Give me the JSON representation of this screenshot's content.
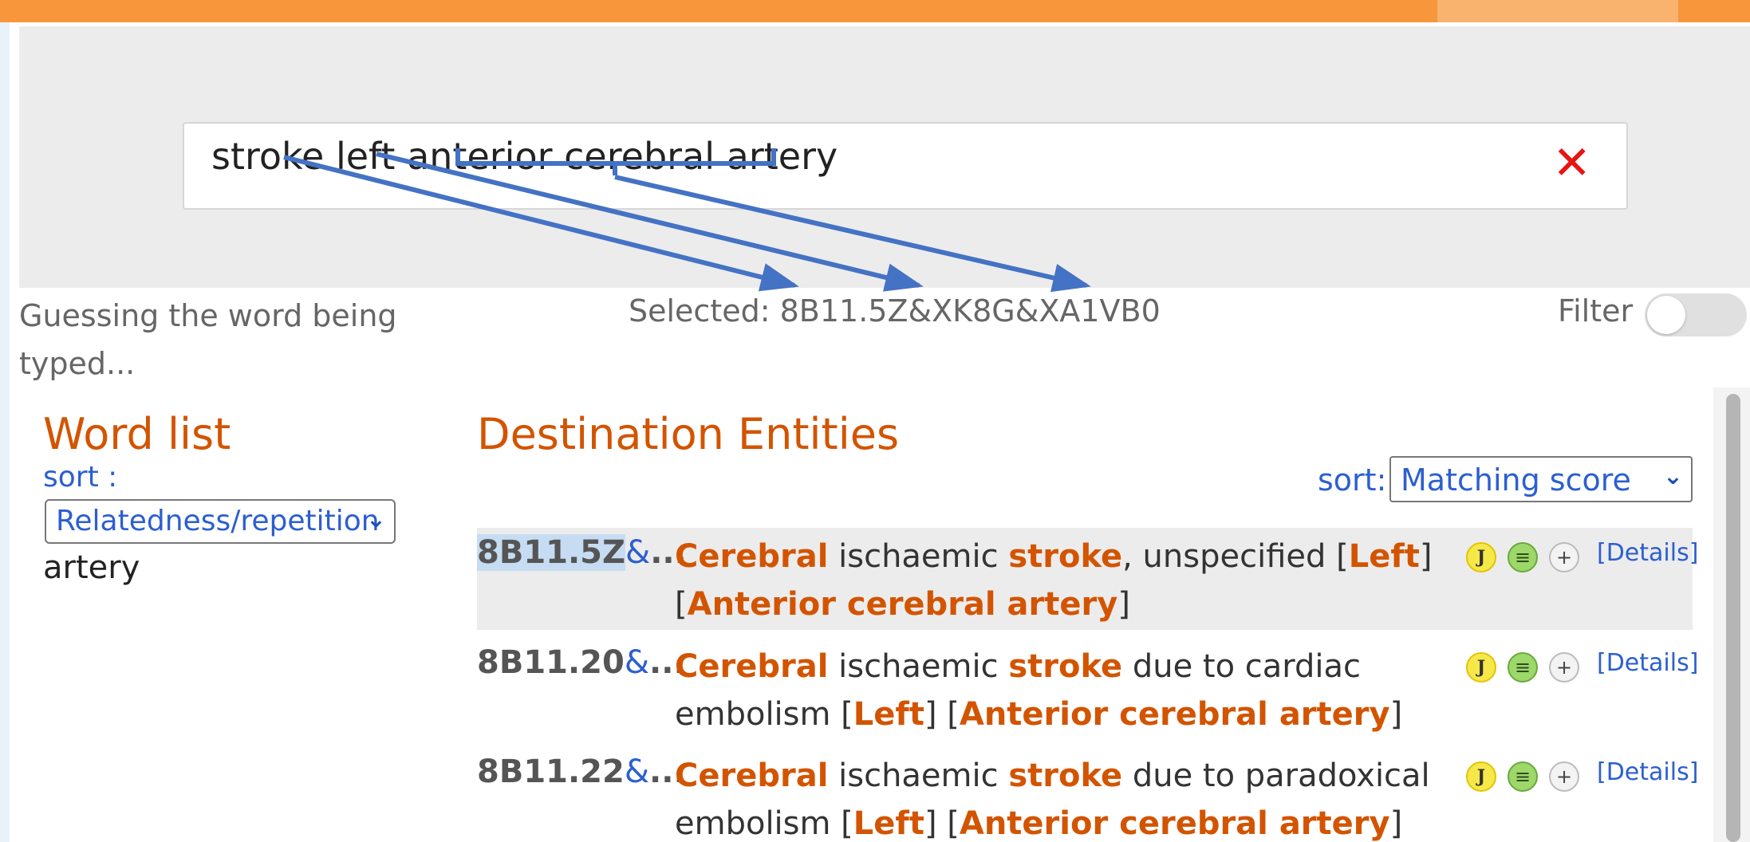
{
  "search": {
    "value": "stroke left anterior cerebral artery",
    "clear_icon": "close-icon"
  },
  "status": {
    "guessing": "Guessing the word being typed...",
    "selected": "Selected: 8B11.5Z&XK8G&XA1VB0",
    "filter_label": "Filter",
    "filter_on": false
  },
  "word_list": {
    "heading": "Word list",
    "sort_label": "sort :",
    "sort_value": "Relatedness/repetition",
    "words": [
      "artery"
    ]
  },
  "destination": {
    "heading": "Destination Entities",
    "sort_label": "sort:",
    "sort_value": "Matching score",
    "details_label": "[Details]",
    "results": [
      {
        "code": "8B11.5Z",
        "amp": "&",
        "ellipsis": "...",
        "segments": [
          {
            "text": "Cerebral",
            "hl": true
          },
          {
            "text": " ischaemic ",
            "hl": false
          },
          {
            "text": "stroke",
            "hl": true
          },
          {
            "text": ", unspecified [",
            "hl": false
          },
          {
            "text": "Left",
            "hl": true
          },
          {
            "text": "] [",
            "hl": false
          },
          {
            "text": "Anterior cerebral artery",
            "hl": true
          },
          {
            "text": "]",
            "hl": false
          }
        ]
      },
      {
        "code": "8B11.20",
        "amp": "&",
        "ellipsis": "...",
        "segments": [
          {
            "text": "Cerebral",
            "hl": true
          },
          {
            "text": " ischaemic ",
            "hl": false
          },
          {
            "text": "stroke",
            "hl": true
          },
          {
            "text": " due to cardiac embolism [",
            "hl": false
          },
          {
            "text": "Left",
            "hl": true
          },
          {
            "text": "] [",
            "hl": false
          },
          {
            "text": "Anterior cerebral artery",
            "hl": true
          },
          {
            "text": "]",
            "hl": false
          }
        ]
      },
      {
        "code": "8B11.22",
        "amp": "&",
        "ellipsis": "...",
        "segments": [
          {
            "text": "Cerebral",
            "hl": true
          },
          {
            "text": " ischaemic ",
            "hl": false
          },
          {
            "text": "stroke",
            "hl": true
          },
          {
            "text": " due to paradoxical embolism [",
            "hl": false
          },
          {
            "text": "Left",
            "hl": true
          },
          {
            "text": "] [",
            "hl": false
          },
          {
            "text": "Anterior cerebral artery",
            "hl": true
          },
          {
            "text": "]",
            "hl": false
          }
        ]
      }
    ],
    "icons": {
      "j": "J",
      "menu": "≡",
      "plus": "+"
    }
  },
  "colors": {
    "accent_orange": "#f7963a",
    "highlight": "#d35400",
    "link_blue": "#2c5fd0",
    "arrow_blue": "#4472c4"
  }
}
